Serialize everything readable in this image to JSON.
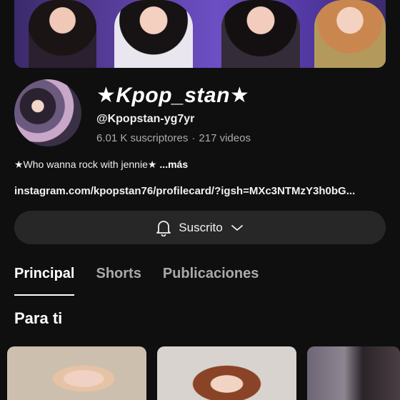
{
  "channel": {
    "name": "★Kpop_stan★",
    "handle": "@Kpopstan-yg7yr",
    "subscribers": "6.01 K suscriptores",
    "separator": "·",
    "videos": "217 videos",
    "description": "★Who wanna rock with jennie★",
    "more_label": "...más",
    "link": "instagram.com/kpopstan76/profilecard/?igsh=MXc3NTMzY3h0bG..."
  },
  "subscribe_button": {
    "label": "Suscrito",
    "icon_left": "bell-icon",
    "icon_right": "chevron-down-icon"
  },
  "tabs": [
    {
      "label": "Principal",
      "active": true
    },
    {
      "label": "Shorts",
      "active": false
    },
    {
      "label": "Publicaciones",
      "active": false
    }
  ],
  "section": {
    "title": "Para ti"
  },
  "colors": {
    "background": "#0f0f0f",
    "button_bg": "#272727",
    "text_primary": "#f1f1f1",
    "text_secondary": "#aaaaaa"
  }
}
